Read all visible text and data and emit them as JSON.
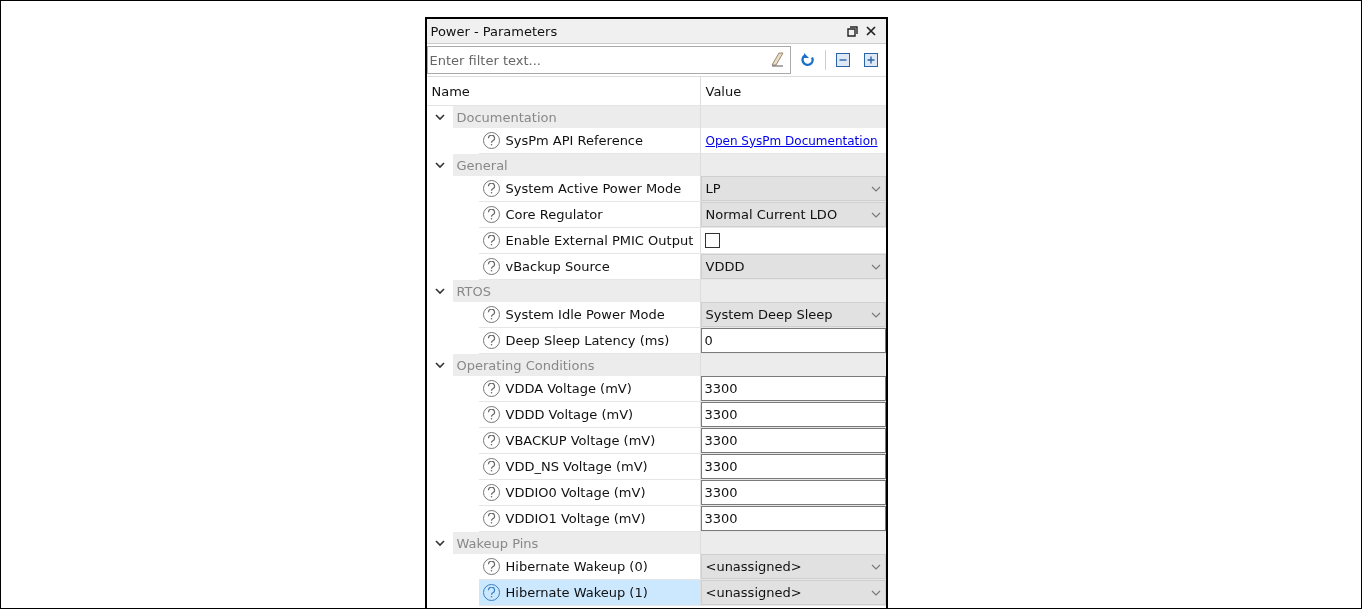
{
  "window": {
    "title": "Power - Parameters"
  },
  "filter": {
    "placeholder": "Enter filter text..."
  },
  "columns": [
    "Name",
    "Value"
  ],
  "groups": [
    {
      "label": "Documentation",
      "expanded": true,
      "params": [
        {
          "name": "SysPm API Reference",
          "kind": "link",
          "value": "Open SysPm Documentation",
          "selected": false
        }
      ]
    },
    {
      "label": "General",
      "expanded": true,
      "params": [
        {
          "name": "System Active Power Mode",
          "kind": "dropdown",
          "value": "LP",
          "selected": false
        },
        {
          "name": "Core Regulator",
          "kind": "dropdown",
          "value": "Normal Current LDO",
          "selected": false
        },
        {
          "name": "Enable External PMIC Output",
          "kind": "checkbox",
          "checked": false,
          "selected": false
        },
        {
          "name": "vBackup Source",
          "kind": "dropdown",
          "value": "VDDD",
          "selected": false
        }
      ]
    },
    {
      "label": "RTOS",
      "expanded": true,
      "params": [
        {
          "name": "System Idle Power Mode",
          "kind": "dropdown",
          "value": "System Deep Sleep",
          "selected": false
        },
        {
          "name": "Deep Sleep Latency (ms)",
          "kind": "text",
          "value": "0",
          "selected": false
        }
      ]
    },
    {
      "label": "Operating Conditions",
      "expanded": true,
      "params": [
        {
          "name": "VDDA Voltage (mV)",
          "kind": "text",
          "value": "3300",
          "selected": false
        },
        {
          "name": "VDDD Voltage (mV)",
          "kind": "text",
          "value": "3300",
          "selected": false
        },
        {
          "name": "VBACKUP Voltage (mV)",
          "kind": "text",
          "value": "3300",
          "selected": false
        },
        {
          "name": "VDD_NS Voltage (mV)",
          "kind": "text",
          "value": "3300",
          "selected": false
        },
        {
          "name": "VDDIO0 Voltage (mV)",
          "kind": "text",
          "value": "3300",
          "selected": false
        },
        {
          "name": "VDDIO1 Voltage (mV)",
          "kind": "text",
          "value": "3300",
          "selected": false
        }
      ]
    },
    {
      "label": "Wakeup Pins",
      "expanded": true,
      "params": [
        {
          "name": "Hibernate Wakeup (0)",
          "kind": "dropdown",
          "value": "<unassigned>",
          "selected": false
        },
        {
          "name": "Hibernate Wakeup (1)",
          "kind": "dropdown",
          "value": "<unassigned>",
          "selected": true
        }
      ]
    }
  ]
}
